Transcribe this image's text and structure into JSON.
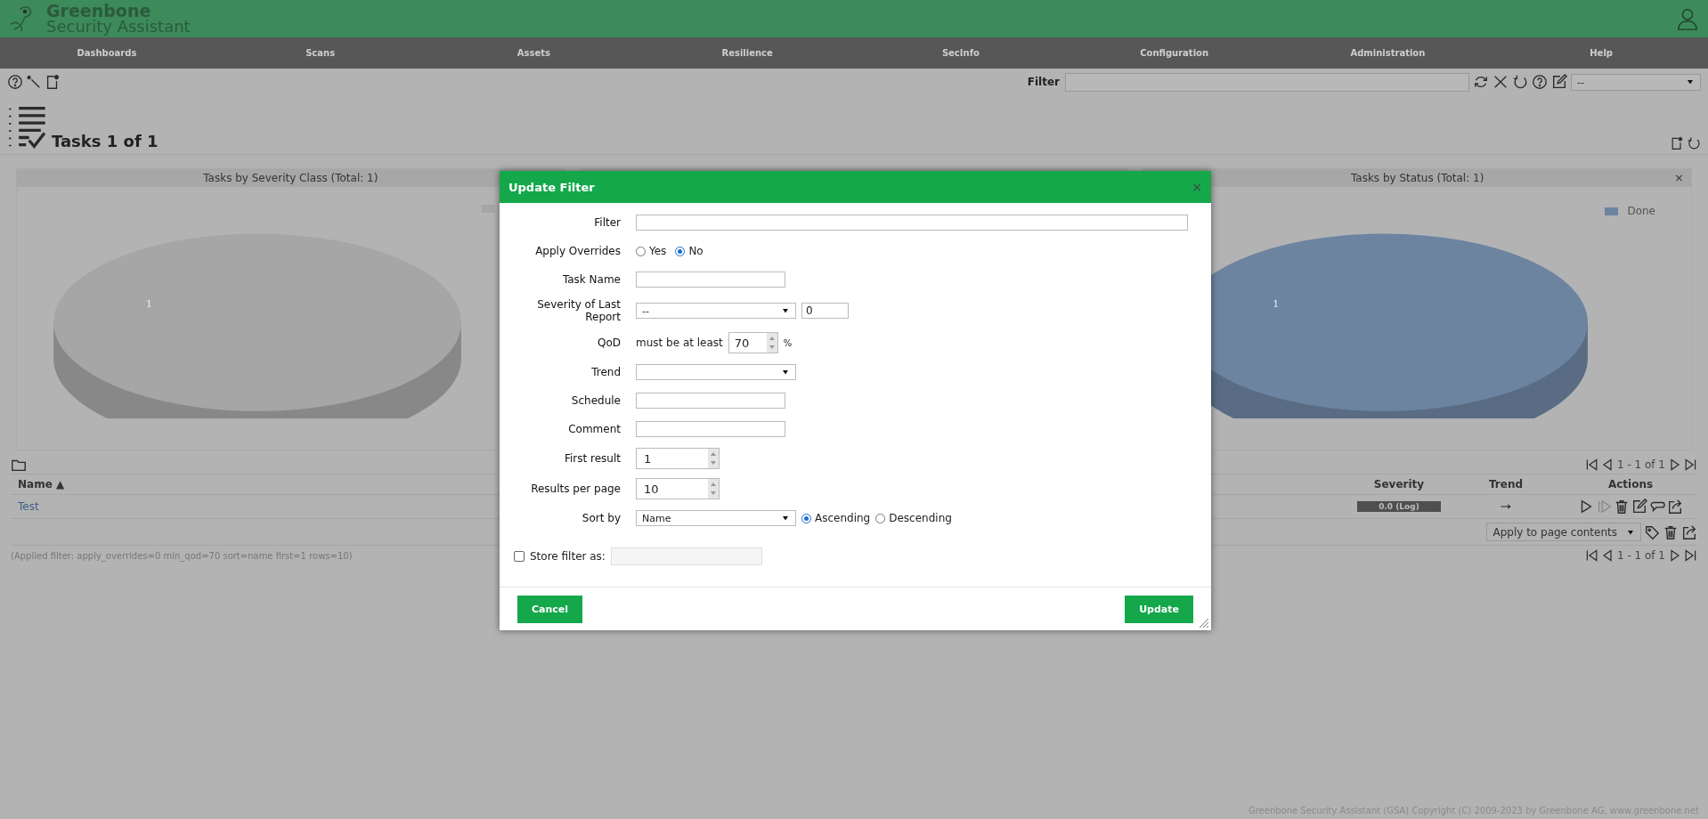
{
  "header": {
    "logo_line1": "Greenbone",
    "logo_line2": "Security Assistant"
  },
  "nav": [
    "Dashboards",
    "Scans",
    "Assets",
    "Resilience",
    "SecInfo",
    "Configuration",
    "Administration",
    "Help"
  ],
  "filter_bar": {
    "label": "Filter",
    "select": "--"
  },
  "page_title": "Tasks 1 of 1",
  "dashboard": [
    {
      "title": "Tasks by Severity Class (Total: 1)",
      "color": "#a6a6a6",
      "slice_label": "1"
    },
    {
      "title": "Tasks by Status (Total: 1)",
      "close": "×",
      "color": "#6c84a0",
      "slice_label": "1",
      "legend": "Done"
    }
  ],
  "pagination_top": "1 - 1 of 1",
  "table": {
    "columns": [
      "Name ▲",
      "Severity",
      "Trend",
      "Actions"
    ],
    "rows": [
      {
        "name": "Test",
        "severity": "0.0 (Log)"
      }
    ]
  },
  "bulk_action": "Apply to page contents",
  "pagination_bottom": "1 - 1 of 1",
  "applied_filter": "(Applied filter: apply_overrides=0 min_qod=70 sort=name first=1 rows=10)",
  "footer": "Greenbone Security Assistant (GSA) Copyright (C) 2009-2023 by Greenbone AG, www.greenbone.net",
  "dialog": {
    "title": "Update Filter",
    "close": "×",
    "fields": [
      {
        "kind": "long_text",
        "label": "Filter"
      },
      {
        "kind": "radio",
        "label": "Apply Overrides",
        "options": [
          {
            "label": "Yes",
            "selected": false
          },
          {
            "label": "No",
            "selected": true
          }
        ]
      },
      {
        "kind": "text",
        "label": "Task Name"
      },
      {
        "kind": "severity",
        "label": "Severity of Last Report",
        "select": "--",
        "value": "0"
      },
      {
        "kind": "qod",
        "label": "QoD",
        "prefix": "must be at least",
        "value": "70",
        "suffix": "%"
      },
      {
        "kind": "select",
        "label": "Trend"
      },
      {
        "kind": "text",
        "label": "Schedule"
      },
      {
        "kind": "text",
        "label": "Comment"
      },
      {
        "kind": "spinner",
        "label": "First result",
        "value": "1"
      },
      {
        "kind": "spinner",
        "label": "Results per page",
        "value": "10"
      },
      {
        "kind": "sort",
        "label": "Sort by",
        "select": "Name",
        "options": [
          {
            "label": "Ascending",
            "selected": true
          },
          {
            "label": "Descending",
            "selected": false
          }
        ]
      }
    ],
    "store": {
      "label": "Store filter as:",
      "checked": false
    },
    "buttons": [
      "Cancel",
      "Update"
    ]
  }
}
